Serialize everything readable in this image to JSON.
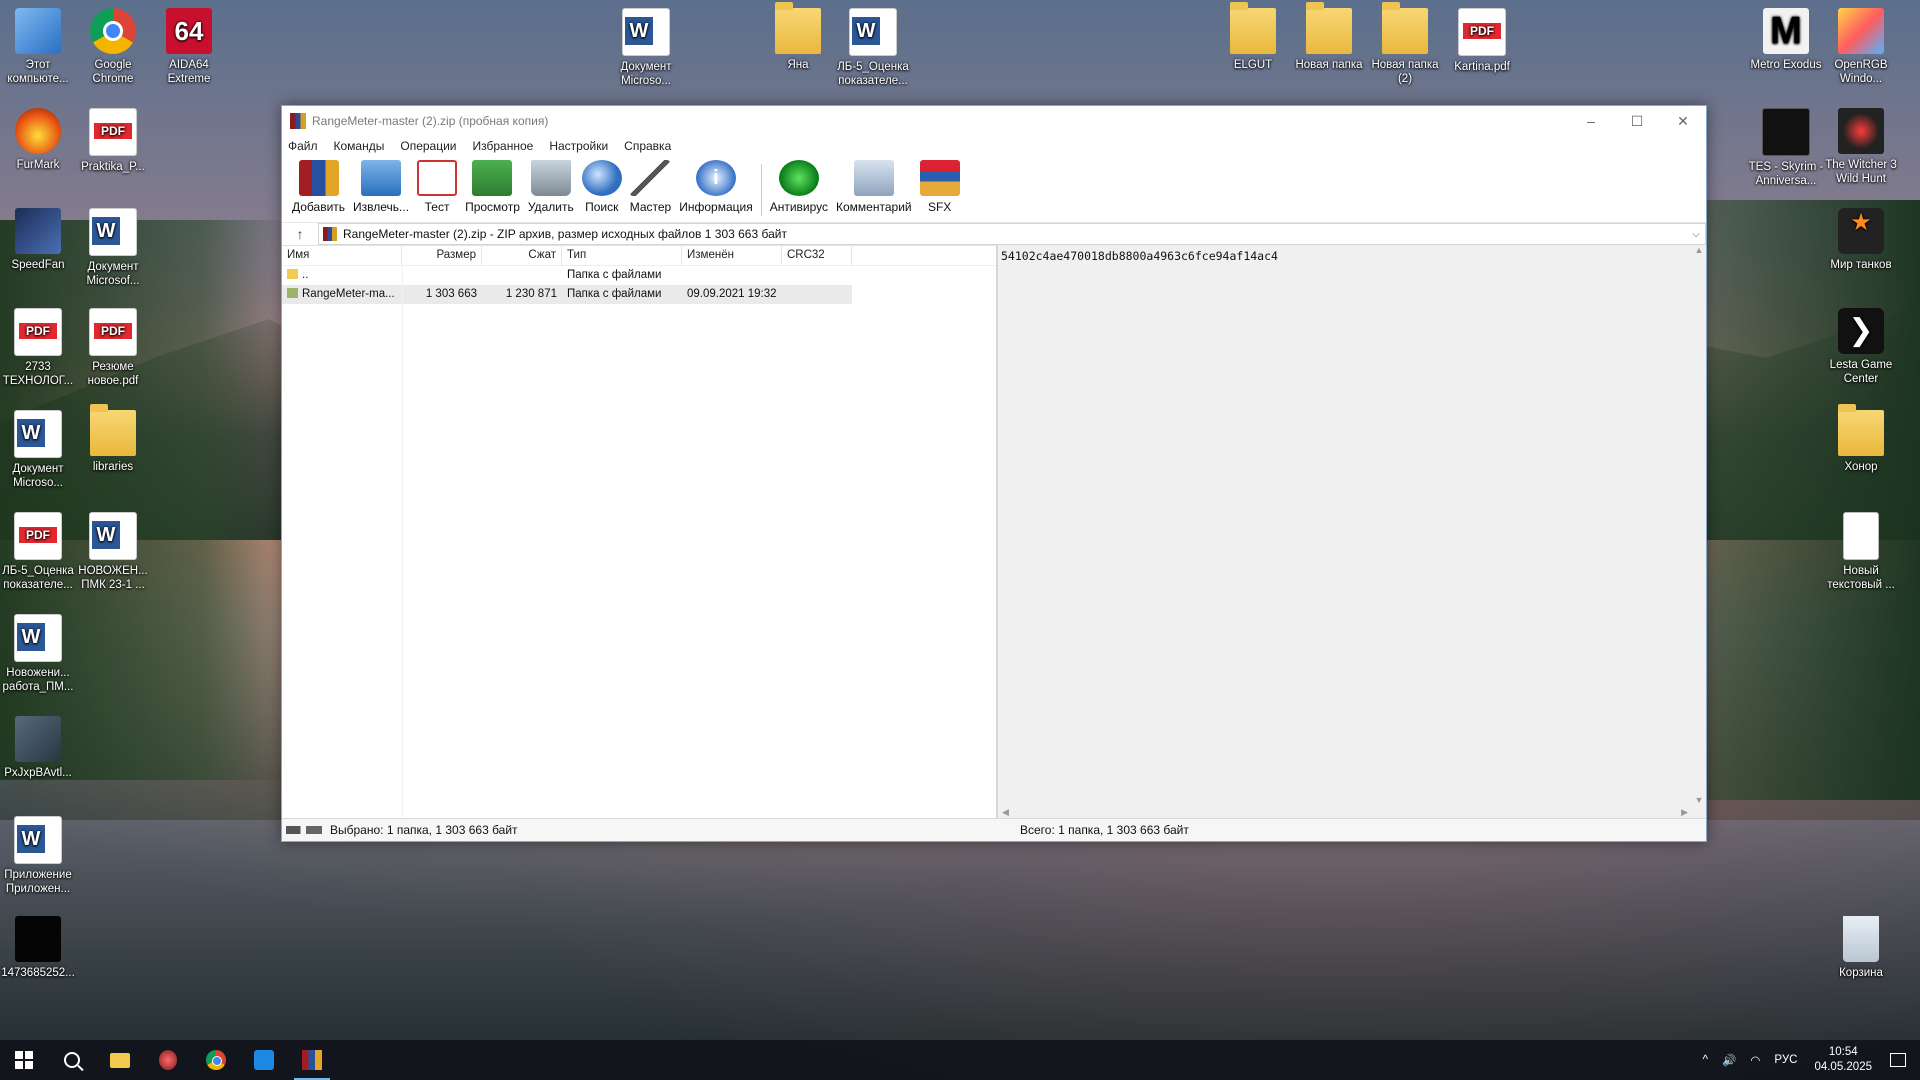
{
  "desktop": {
    "icons_left": [
      {
        "label": "Этот компьюте..."
      },
      {
        "label": "Google Chrome"
      },
      {
        "label": "AIDA64 Extreme"
      },
      {
        "label": "FurMark"
      },
      {
        "label": "Praktika_P..."
      },
      {
        "label": "SpeedFan"
      },
      {
        "label": "Документ Microsof..."
      },
      {
        "label": "2733 ТЕХНОЛОГ..."
      },
      {
        "label": "Резюме новое.pdf"
      },
      {
        "label": "Документ Microso..."
      },
      {
        "label": "libraries"
      },
      {
        "label": "ЛБ-5_Оценка показателе..."
      },
      {
        "label": "НОВОЖЕН... ПМК 23-1 ..."
      },
      {
        "label": "Новожени... работа_ПМ..."
      },
      {
        "label": "PxJxpBAvtl..."
      },
      {
        "label": "Приложение Приложен..."
      },
      {
        "label": "1473685252..."
      }
    ],
    "icons_top": [
      {
        "label": "Документ Microso..."
      },
      {
        "label": "Яна"
      },
      {
        "label": "ЛБ-5_Оценка показателе..."
      },
      {
        "label": "ELGUT"
      },
      {
        "label": "Новая папка"
      },
      {
        "label": "Новая папка (2)"
      },
      {
        "label": "Kartina.pdf"
      }
    ],
    "icons_right": [
      {
        "label": "Metro Exodus"
      },
      {
        "label": "OpenRGB Windo..."
      },
      {
        "label": "TES - Skyrim - Anniversa..."
      },
      {
        "label": "The Witcher 3 Wild Hunt"
      },
      {
        "label": "Мир танков"
      },
      {
        "label": "Lesta Game Center"
      },
      {
        "label": "Хонор"
      },
      {
        "label": "Новый текстовый ..."
      },
      {
        "label": "Корзина"
      }
    ],
    "icon_text": {
      "aida": "64",
      "pdf": "PDF",
      "word": "W",
      "metro": "M",
      "lesta": "❯"
    }
  },
  "window": {
    "title": "RangeMeter-master (2).zip (пробная копия)",
    "controls": {
      "minimize": "–",
      "maximize": "☐",
      "close": "✕"
    },
    "menu": [
      "Файл",
      "Команды",
      "Операции",
      "Избранное",
      "Настройки",
      "Справка"
    ],
    "toolbar": [
      {
        "label": "Добавить",
        "icon": "add-icon"
      },
      {
        "label": "Извлечь...",
        "icon": "extract-icon"
      },
      {
        "label": "Тест",
        "icon": "test-icon"
      },
      {
        "label": "Просмотр",
        "icon": "view-icon"
      },
      {
        "label": "Удалить",
        "icon": "delete-icon"
      },
      {
        "label": "Поиск",
        "icon": "find-icon"
      },
      {
        "label": "Мастер",
        "icon": "wizard-icon"
      },
      {
        "label": "Информация",
        "icon": "info-icon"
      },
      {
        "label": "Антивирус",
        "icon": "antivirus-icon"
      },
      {
        "label": "Комментарий",
        "icon": "comment-icon"
      },
      {
        "label": "SFX",
        "icon": "sfx-icon"
      }
    ],
    "info_glyph": "i",
    "address": {
      "up": "↑",
      "path": "RangeMeter-master (2).zip - ZIP архив, размер исходных файлов 1 303 663 байт",
      "dropdown": "⌵"
    },
    "columns": {
      "name": "Имя",
      "size": "Размер",
      "packed": "Сжат",
      "type": "Тип",
      "modified": "Изменён",
      "crc": "CRC32"
    },
    "rows": [
      {
        "name": "..",
        "size": "",
        "packed": "",
        "type": "Папка с файлами",
        "modified": "",
        "crc": ""
      },
      {
        "name": "RangeMeter-ma...",
        "size": "1 303 663",
        "packed": "1 230 871",
        "type": "Папка с файлами",
        "modified": "09.09.2021 19:32",
        "crc": ""
      }
    ],
    "comment_text": "54102c4ae470018db8800a4963c6fce94af14ac4",
    "scroll": {
      "up": "▲",
      "down": "▼",
      "left": "◀",
      "right": "▶"
    },
    "status_left": "Выбрано: 1 папка, 1 303 663 байт",
    "status_right": "Всего: 1 папка, 1 303 663 байт"
  },
  "taskbar": {
    "tray": {
      "chevron": "^",
      "volume": "🔊",
      "wifi": "◠",
      "lang": "РУС"
    },
    "time": "10:54",
    "date": "04.05.2025"
  }
}
